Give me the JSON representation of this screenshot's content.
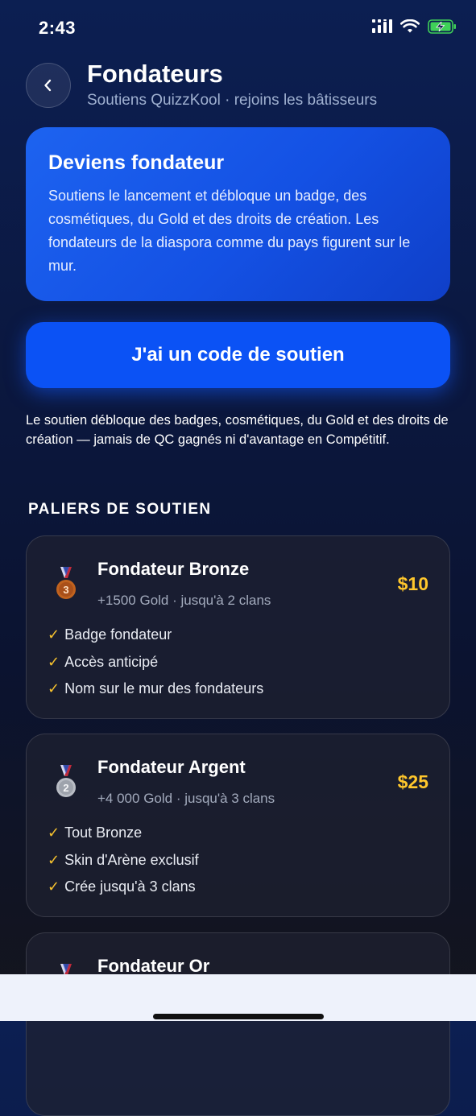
{
  "status": {
    "time": "2:43"
  },
  "header": {
    "title": "Fondateurs",
    "subtitle": "Soutiens QuizzKool · rejoins les bâtisseurs"
  },
  "hero": {
    "title": "Deviens fondateur",
    "text": "Soutiens le lancement et débloque un badge, des cosmétiques, du Gold et des droits de création. Les fondateurs de la diaspora comme du pays figurent sur le mur."
  },
  "code_button": {
    "label": "J'ai un code de soutien"
  },
  "disclaimer": "Le soutien débloque des badges, cosmétiques, du Gold et des droits de création — jamais de QC gagnés ni d'avantage en Compétitif.",
  "section": {
    "title": "PALIERS DE SOUTIEN"
  },
  "tiers": [
    {
      "name": "Fondateur Bronze",
      "meta": "+1500 Gold · jusqu'à 2 clans",
      "price": "$10",
      "medal_number": "3",
      "perks": [
        "Badge fondateur",
        "Accès anticipé",
        "Nom sur le mur des fondateurs"
      ]
    },
    {
      "name": "Fondateur Argent",
      "meta": "+4 000 Gold · jusqu'à 3 clans",
      "price": "$25",
      "medal_number": "2",
      "perks": [
        "Tout Bronze",
        "Skin d'Arène exclusif",
        "Crée jusqu'à 3 clans"
      ]
    },
    {
      "name": "Fondateur Or",
      "meta": "",
      "price": "",
      "perks": []
    }
  ],
  "check_glyph": "✓",
  "colors": {
    "accent_blue": "#0b52f5",
    "price_gold": "#ffc72c",
    "bronze": "#c0621e",
    "silver": "#a9adb5",
    "battery_green": "#3fd158"
  },
  "icons": [
    "back-chevron-icon",
    "signal-icon",
    "wifi-icon",
    "battery-charging-icon",
    "medal-icon"
  ]
}
